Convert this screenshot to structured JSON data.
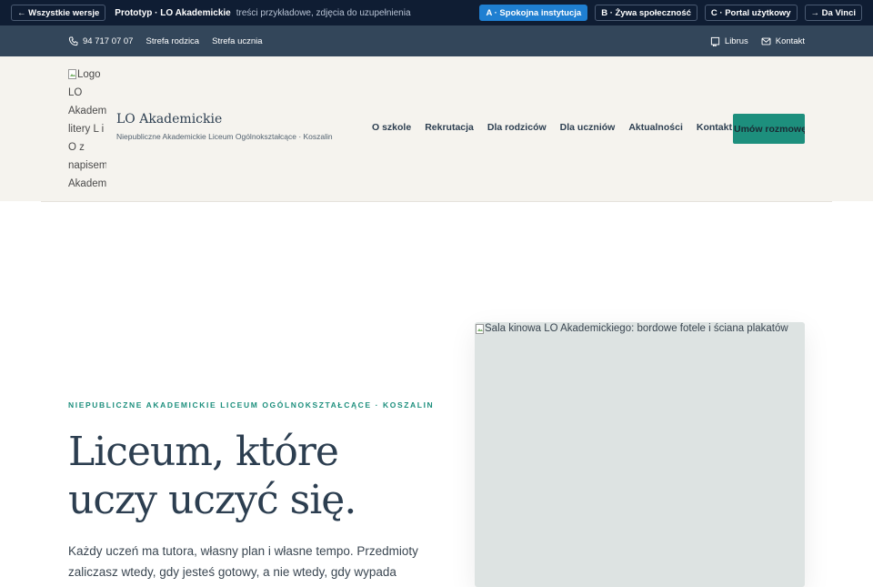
{
  "proto_bar": {
    "back_label": "← Wszystkie wersje",
    "title": "Prototyp · LO Akademickie",
    "note": "treści przykładowe, zdjęcia do uzupełnienia",
    "variants": [
      {
        "label": "A · Spokojna instytucja",
        "active": true
      },
      {
        "label": "B · Żywa społeczność",
        "active": false
      },
      {
        "label": "C · Portal użytkowy",
        "active": false
      },
      {
        "label": "→ Da Vinci",
        "active": false
      }
    ],
    "active_color": "#1f7fd1"
  },
  "utility_bar": {
    "phone": "94 717 07 07",
    "links": [
      "Strefa rodzica",
      "Strefa ucznia"
    ],
    "librus": "Librus",
    "contact": "Kontakt"
  },
  "header": {
    "logo_alt": "Logo LO Akademickie: litery L i O z napisem Akademickie",
    "brand_name": "LO Akademickie",
    "brand_sub": "Niepubliczne Akademickie Liceum Ogólnokształcące · Koszalin",
    "nav": [
      "O szkole",
      "Rekrutacja",
      "Dla rodziców",
      "Dla uczniów",
      "Aktualności",
      "Kontakt"
    ],
    "cta": "Umów rozmowę"
  },
  "hero": {
    "eyebrow": "NIEPUBLICZNE AKADEMICKIE LICEUM OGÓLNOKSZTAŁCĄCE · KOSZALIN",
    "title_line1": "Liceum, które",
    "title_line2": "uczy uczyć się.",
    "lead": "Każdy uczeń ma tutora, własny plan i własne tempo. Przedmioty zaliczasz wtedy, gdy jesteś gotowy, a nie wtedy, gdy wypada kalendarz.",
    "image_alt": "Sala kinowa LO Akademickiego: bordowe fotele i ściana plakatów"
  },
  "colors": {
    "accent": "#1d8f7d",
    "primary_text": "#2c3e50",
    "utility_bg": "#33465a",
    "proto_bg": "#0f1d33",
    "header_bg": "#f5f3ee"
  }
}
